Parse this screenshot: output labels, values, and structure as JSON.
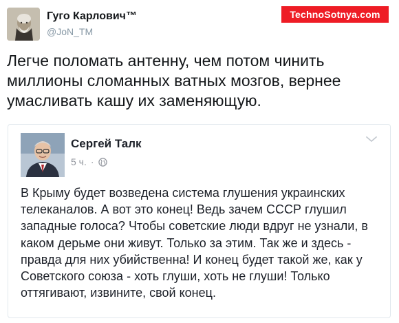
{
  "tweet": {
    "author_name": "Гуго Карлович™",
    "author_handle": "@JoN_TM",
    "text": "Легче поломать антенну, чем потом чинить миллионы сломанных ватных мозгов, вернее умасливать кашу их заменяющую."
  },
  "watermark": {
    "text": "TechnoSotnya.com",
    "color": "#ee1c25"
  },
  "quoted_post": {
    "author_name": "Сергей Талк",
    "timestamp": "5 ч.",
    "separator": "·",
    "privacy_icon": "globe-icon",
    "menu_icon": "chevron-down-icon",
    "text": "В Крыму будет возведена система глушения украинских телеканалов. А вот это конец! Ведь зачем СССР глушил западные голоса? Чтобы советские люди вдруг не узнали, в каком дерьме они живут. Только за этим. Так же и здесь - правда для них убийственна! И конец будет такой же, как у Советского союза  - хоть глуши, хоть не глуши! Только оттягивают, извините, свой конец."
  }
}
